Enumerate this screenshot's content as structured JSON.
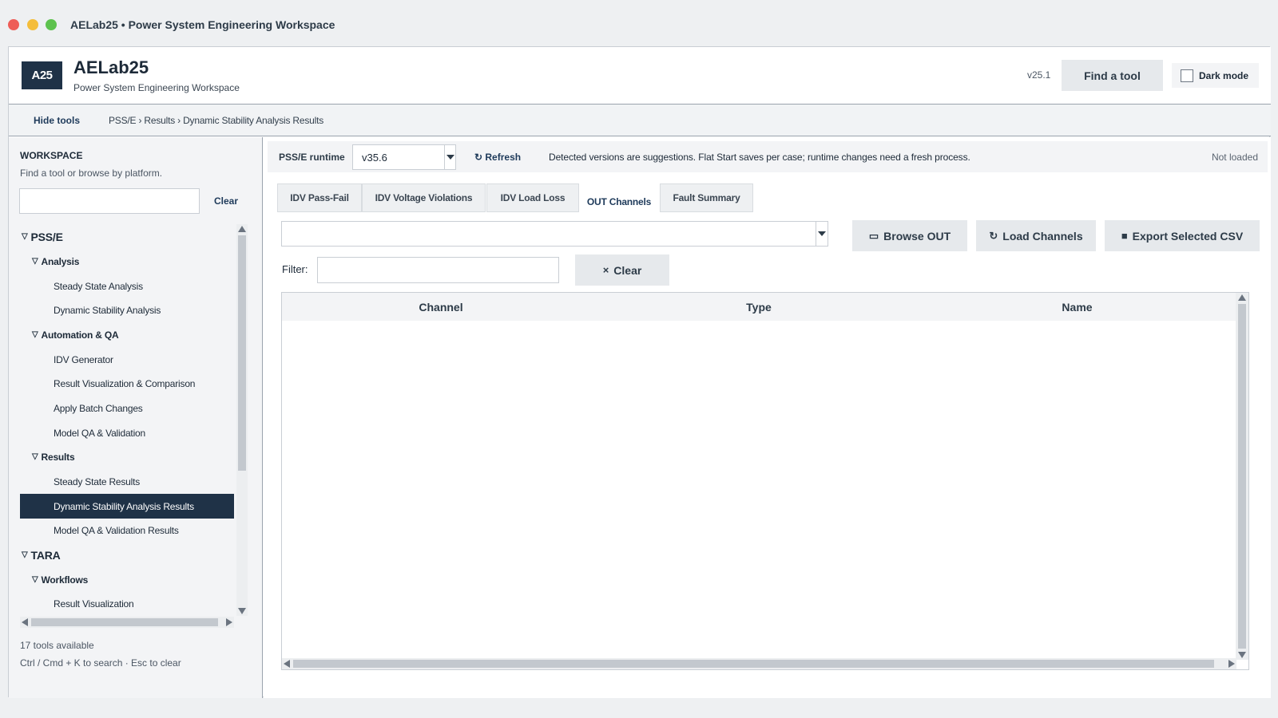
{
  "window": {
    "title": "AELab25 • Power System Engineering Workspace"
  },
  "header": {
    "logo_text": "A25",
    "app_name": "AELab25",
    "app_subtitle": "Power System Engineering Workspace",
    "version": "v25.1",
    "find_tool_label": "Find a tool",
    "dark_mode_label": "Dark mode",
    "dark_mode_checked": false
  },
  "toolbar": {
    "hide_tools_label": "Hide tools",
    "breadcrumb": "PSS/E › Results › Dynamic Stability Analysis Results"
  },
  "sidebar": {
    "title": "WORKSPACE",
    "subtitle": "Find a tool or browse by platform.",
    "search_value": "",
    "clear_label": "Clear",
    "tree": [
      {
        "label": "PSS/E",
        "level": 0,
        "expanded": true
      },
      {
        "label": "Analysis",
        "level": 1,
        "expanded": true
      },
      {
        "label": "Steady State Analysis",
        "level": 2
      },
      {
        "label": "Dynamic Stability Analysis",
        "level": 2
      },
      {
        "label": "Automation & QA",
        "level": 1,
        "expanded": true
      },
      {
        "label": "IDV Generator",
        "level": 2
      },
      {
        "label": "Result Visualization & Comparison",
        "level": 2
      },
      {
        "label": "Apply Batch Changes",
        "level": 2
      },
      {
        "label": "Model QA & Validation",
        "level": 2
      },
      {
        "label": "Results",
        "level": 1,
        "expanded": true
      },
      {
        "label": "Steady State Results",
        "level": 2
      },
      {
        "label": "Dynamic Stability Analysis Results",
        "level": 2,
        "selected": true
      },
      {
        "label": "Model QA & Validation Results",
        "level": 2
      },
      {
        "label": "TARA",
        "level": 0,
        "expanded": true
      },
      {
        "label": "Workflows",
        "level": 1,
        "expanded": true
      },
      {
        "label": "Result Visualization",
        "level": 2
      }
    ],
    "tool_count": "17 tools available",
    "shortcut_hint": "Ctrl / Cmd + K to search · Esc to clear"
  },
  "runtime": {
    "label": "PSS/E runtime",
    "selected_version": "v35.6",
    "refresh_label": "Refresh",
    "note": "Detected versions are suggestions. Flat Start saves per case; runtime changes need a fresh process.",
    "status": "Not loaded"
  },
  "tabs": [
    {
      "label": "IDV Pass-Fail",
      "active": false
    },
    {
      "label": "IDV Voltage Violations",
      "active": false
    },
    {
      "label": "IDV Load Loss",
      "active": false
    },
    {
      "label": "OUT Channels",
      "active": true
    },
    {
      "label": "Fault Summary",
      "active": false
    }
  ],
  "out_channels": {
    "file_value": "",
    "browse_label": "Browse OUT",
    "load_label": "Load Channels",
    "export_label": "Export Selected CSV",
    "filter_label": "Filter:",
    "filter_value": "",
    "clear_label": "Clear",
    "columns": [
      "Channel",
      "Type",
      "Name"
    ],
    "rows": []
  },
  "icons": {
    "folder": "folder-icon",
    "refresh": "refresh-icon",
    "export": "square-icon",
    "clear": "x-icon",
    "triangle": "triangle-down-icon"
  },
  "colors": {
    "primary_dark": "#1f3247",
    "selected_row": "#1f3247",
    "traffic_red": "#ee5d57",
    "traffic_yellow": "#f4bd3a",
    "traffic_green": "#5dc24e"
  }
}
